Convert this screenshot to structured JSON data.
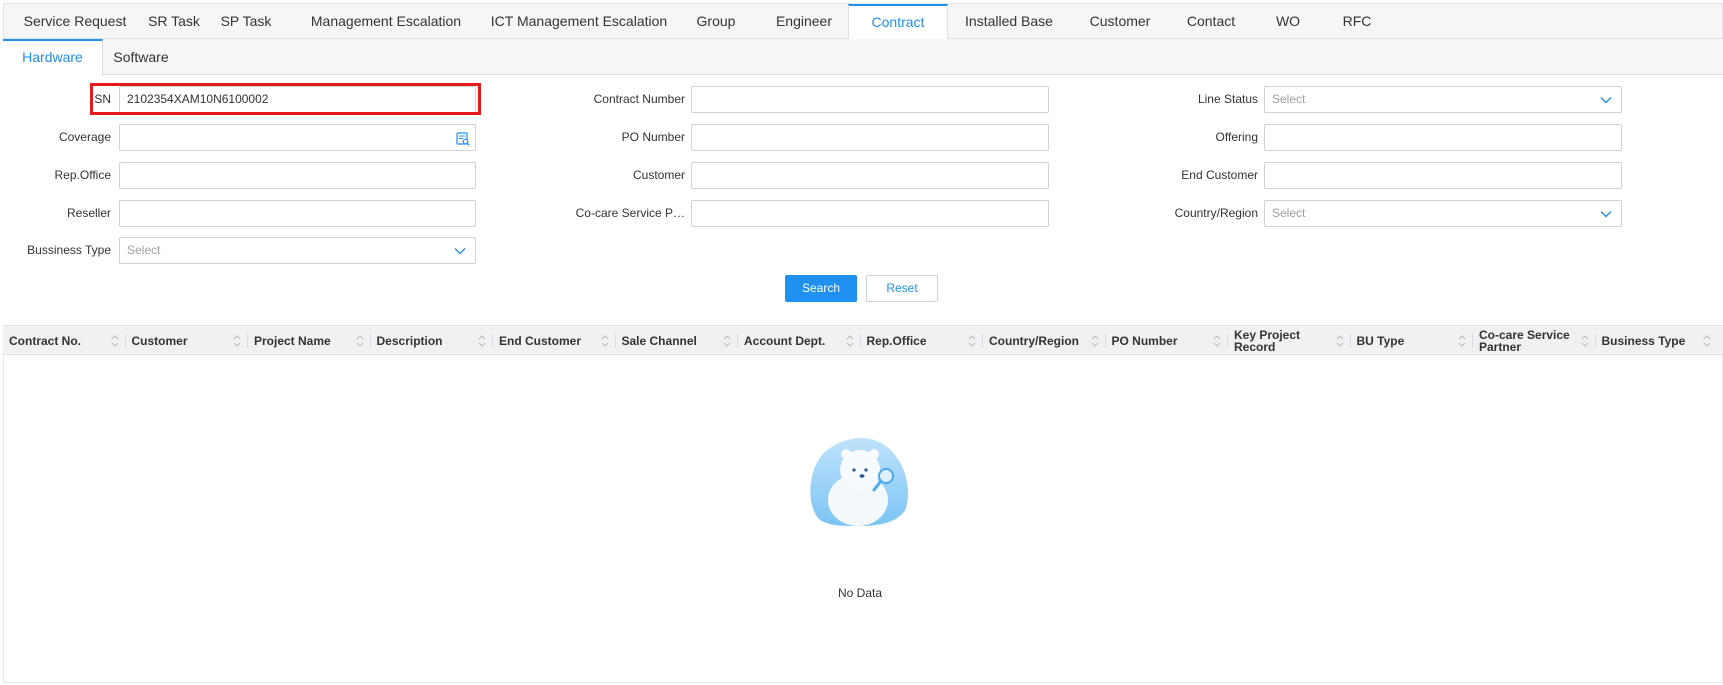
{
  "main_tabs": [
    {
      "label": "Service Request"
    },
    {
      "label": "SR Task"
    },
    {
      "label": "SP Task"
    },
    {
      "label": "Management Escalation"
    },
    {
      "label": "ICT Management Escalation"
    },
    {
      "label": "Group"
    },
    {
      "label": "Engineer"
    },
    {
      "label": "Contract",
      "active": true
    },
    {
      "label": "Installed Base"
    },
    {
      "label": "Customer"
    },
    {
      "label": "Contact"
    },
    {
      "label": "WO"
    },
    {
      "label": "RFC"
    }
  ],
  "sub_tabs": [
    {
      "label": "Hardware",
      "active": true
    },
    {
      "label": "Software"
    }
  ],
  "form": {
    "sn": {
      "label": "SN",
      "value": "2102354XAM10N6100002"
    },
    "coverage": {
      "label": "Coverage",
      "value": ""
    },
    "rep_office": {
      "label": "Rep.Office",
      "value": ""
    },
    "reseller": {
      "label": "Reseller",
      "value": ""
    },
    "business_type": {
      "label": "Bussiness Type",
      "placeholder": "Select"
    },
    "contract_number": {
      "label": "Contract Number",
      "value": ""
    },
    "po_number": {
      "label": "PO Number",
      "value": ""
    },
    "customer": {
      "label": "Customer",
      "value": ""
    },
    "cocare_partner": {
      "label": "Co-care Service P…",
      "value": ""
    },
    "line_status": {
      "label": "Line Status",
      "placeholder": "Select"
    },
    "offering": {
      "label": "Offering",
      "value": ""
    },
    "end_customer": {
      "label": "End Customer",
      "value": ""
    },
    "country_region": {
      "label": "Country/Region",
      "placeholder": "Select"
    }
  },
  "buttons": {
    "search": "Search",
    "reset": "Reset"
  },
  "table": {
    "columns": [
      "Contract No.",
      "Customer",
      "Project Name",
      "Description",
      "End Customer",
      "Sale Channel",
      "Account Dept.",
      "Rep.Office",
      "Country/Region",
      "PO Number",
      "Key Project Record",
      "BU Type",
      "Co-care Service Partner",
      "Business Type"
    ],
    "rows": [],
    "empty_text": "No Data"
  },
  "icons": {
    "lookup": "lookup-icon",
    "chevron": "chevron-down-icon",
    "sort": "sort-icon",
    "empty": "polar-bear-empty-illustration"
  },
  "colors": {
    "accent": "#1f8ff0",
    "highlight": "#e41a1c"
  }
}
